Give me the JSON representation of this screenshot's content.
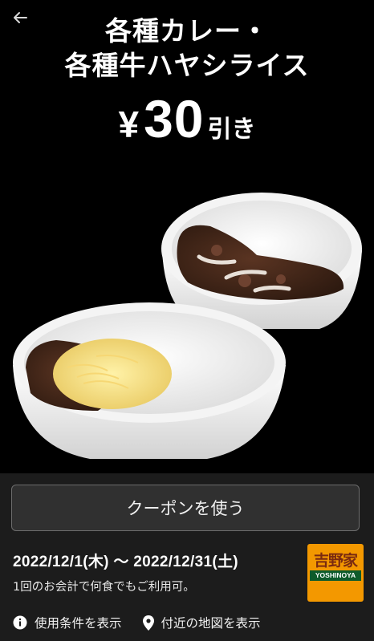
{
  "nav": {
    "back_icon": "arrow-left-icon"
  },
  "coupon": {
    "title_line1": "各種カレー・",
    "title_line2": "各種牛ハヤシライス",
    "price_currency": "¥",
    "price_amount": "30",
    "price_suffix": "引き"
  },
  "actions": {
    "use_label": "クーポンを使う"
  },
  "validity": {
    "period": "2022/12/1(木) ～ 2022/12/31(土)",
    "note": "1回のお会計で何食でもご利用可。"
  },
  "brand": {
    "logo_kanji": "吉野家",
    "logo_latin": "YOSHINOYA",
    "color_primary": "#f39800",
    "color_secondary": "#0e5b2b"
  },
  "footer_links": {
    "terms_label": "使用条件を表示",
    "terms_icon": "info-icon",
    "map_label": "付近の地図を表示",
    "map_icon": "location-pin-icon"
  },
  "colors": {
    "background": "#000000",
    "panel": "#1c1c1c",
    "button": "#303030"
  }
}
